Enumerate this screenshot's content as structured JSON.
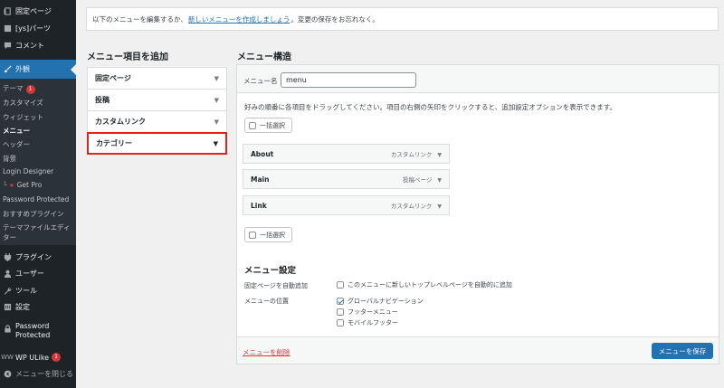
{
  "sidebar": {
    "top_items": [
      {
        "label": "固定ページ",
        "icon": "pages-icon"
      },
      {
        "label": "[ys]パーツ",
        "icon": "parts-icon"
      },
      {
        "label": "コメント",
        "icon": "comment-icon"
      }
    ],
    "active_item": {
      "label": "外観",
      "icon": "brush-icon"
    },
    "submenu": {
      "theme": "テーマ",
      "theme_badge": "1",
      "customize": "カスタマイズ",
      "widgets": "ウィジェット",
      "menus": "メニュー",
      "header": "ヘッダー",
      "background": "背景",
      "login_designer": "Login Designer",
      "get_pro": "Get Pro",
      "password_protected": "Password Protected",
      "recommended_plugins": "おすすめプラグイン",
      "theme_editor_line1": "テーマファイルエディ",
      "theme_editor_line2": "ター"
    },
    "bottom_items": {
      "plugins": "プラグイン",
      "users": "ユーザー",
      "tools": "ツール",
      "settings": "設定",
      "password_protected_line1": "Password",
      "password_protected_line2": "Protected",
      "wp_ulike": "WP ULike",
      "wp_ulike_badge": "1",
      "collapse": "メニューを閉じる"
    }
  },
  "notice": {
    "before": "以下のメニューを編集するか、",
    "link": "新しいメニューを作成しましょう",
    "after": "。変更の保存をお忘れなく。"
  },
  "add_items": {
    "heading": "メニュー項目を追加",
    "sections": [
      {
        "label": "固定ページ"
      },
      {
        "label": "投稿"
      },
      {
        "label": "カスタムリンク"
      },
      {
        "label": "カテゴリー"
      }
    ]
  },
  "structure": {
    "heading": "メニュー構造",
    "name_label": "メニュー名",
    "name_value": "menu",
    "instructions": "好みの順番に各項目をドラッグしてください。項目の右側の矢印をクリックすると、追加設定オプションを表示できます。",
    "bulk_select": "一括選択",
    "items": [
      {
        "title": "About",
        "type": "カスタムリンク"
      },
      {
        "title": "Main",
        "type": "投稿ページ"
      },
      {
        "title": "Link",
        "type": "カスタムリンク"
      }
    ],
    "settings": {
      "heading": "メニュー設定",
      "auto_add_label": "固定ページを自動追加",
      "auto_add_option": "このメニューに新しいトップレベルページを自動的に追加",
      "location_label": "メニューの位置",
      "locations": [
        {
          "label": "グローバルナビゲーション",
          "checked": true
        },
        {
          "label": "フッターメニュー",
          "checked": false
        },
        {
          "label": "モバイルフッター",
          "checked": false
        }
      ]
    },
    "delete_label": "メニューを削除",
    "save_label": "メニューを保存"
  },
  "colors": {
    "sidebar_bg": "#1d2327",
    "accent": "#2271b1",
    "highlight_border": "#e0241a",
    "delete_red": "#d63638"
  }
}
